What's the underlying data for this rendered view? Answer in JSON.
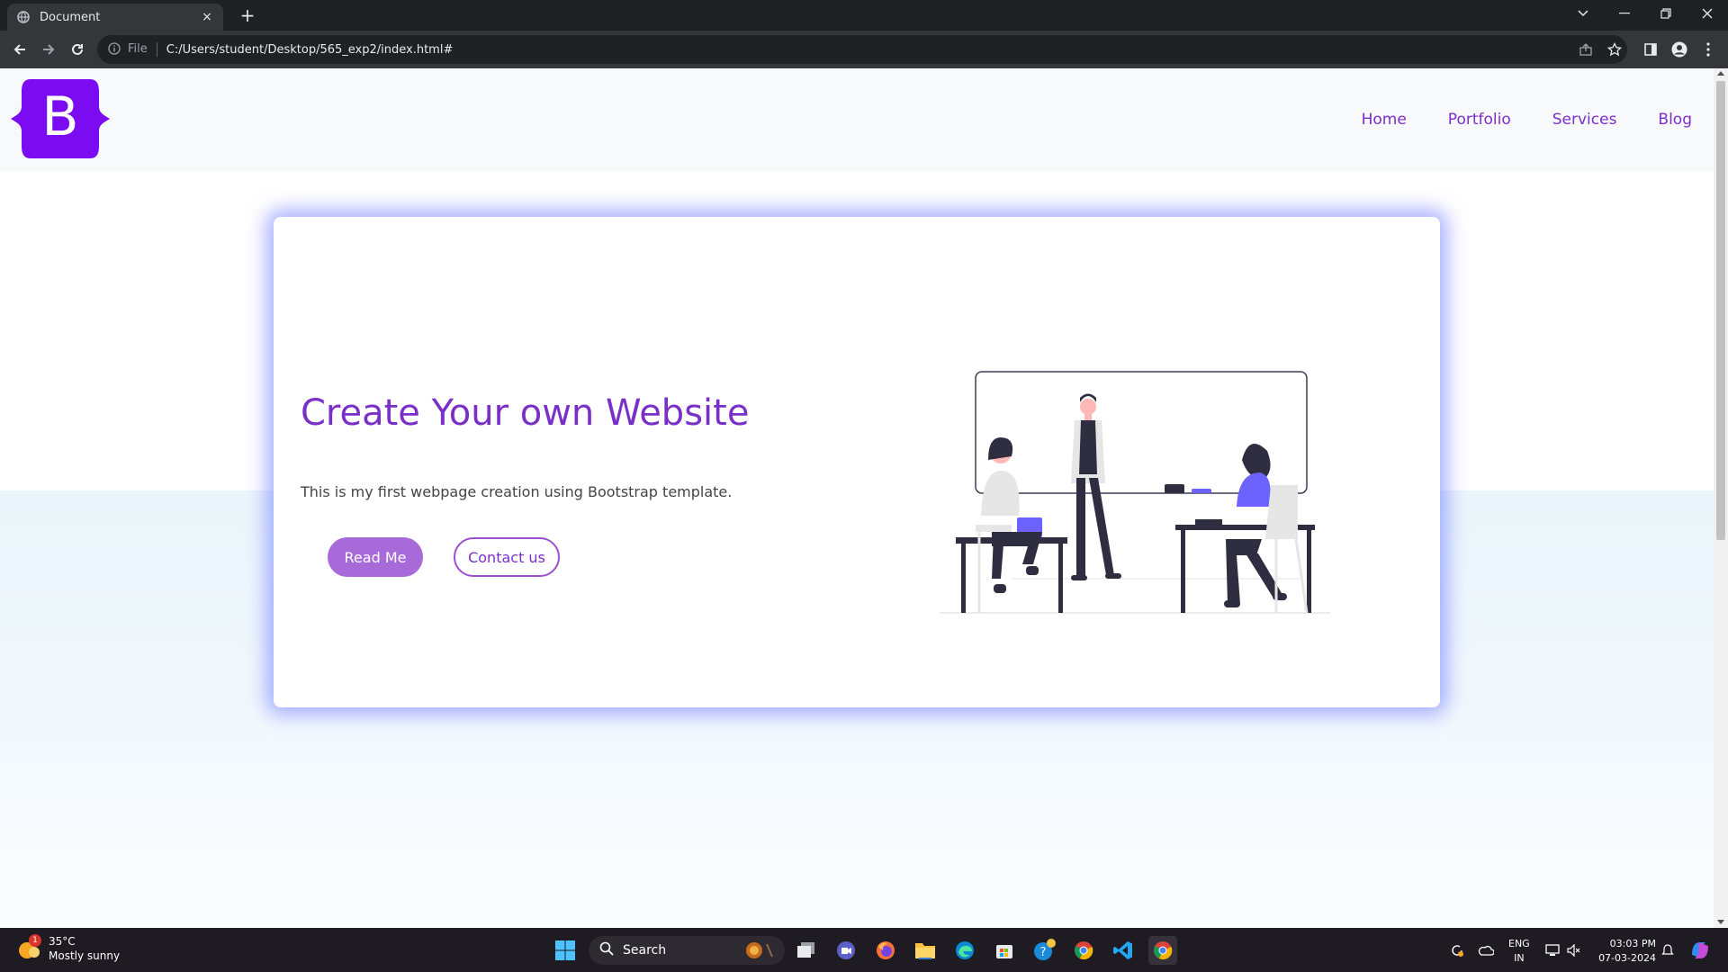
{
  "browser": {
    "tab_title": "Document",
    "tab_close": "×",
    "new_tab": "+",
    "omnibox_file_label": "File",
    "url": "C:/Users/student/Desktop/565_exp2/index.html#"
  },
  "site": {
    "logo_letter": "B",
    "nav": [
      "Home",
      "Portfolio",
      "Services",
      "Blog"
    ],
    "hero": {
      "title": "Create Your own Website",
      "text": "This is my first webpage creation using Bootstrap template.",
      "read_button": "Read Me",
      "contact_button": "Contact us"
    }
  },
  "taskbar": {
    "weather_temp": "35°C",
    "weather_desc": "Mostly sunny",
    "weather_badge": "1",
    "search_label": "Search",
    "lang_top": "ENG",
    "lang_bottom": "IN",
    "time": "03:03 PM",
    "date": "07-03-2024"
  },
  "colors": {
    "accent": "#7b2fc9",
    "brand_logo": "#7b0cf2",
    "read_button": "#a86ad8",
    "card_glow": "#626eff"
  },
  "icons": {
    "tab": [
      "favicon-icon"
    ],
    "toolbar": [
      "back-icon",
      "forward-icon",
      "reload-icon",
      "info-icon",
      "share-icon",
      "bookmark-star-icon",
      "side-panel-icon",
      "profile-icon",
      "menu-icon"
    ],
    "window": [
      "tab-search-icon",
      "minimize-icon",
      "restore-icon",
      "close-icon"
    ],
    "taskbar": [
      "windows-start-icon",
      "search-icon",
      "task-view-icon",
      "teams-icon",
      "firefox-icon",
      "file-explorer-icon",
      "edge-icon",
      "store-icon",
      "help-icon",
      "chrome-icon",
      "vscode-icon",
      "chrome-active-icon"
    ]
  }
}
